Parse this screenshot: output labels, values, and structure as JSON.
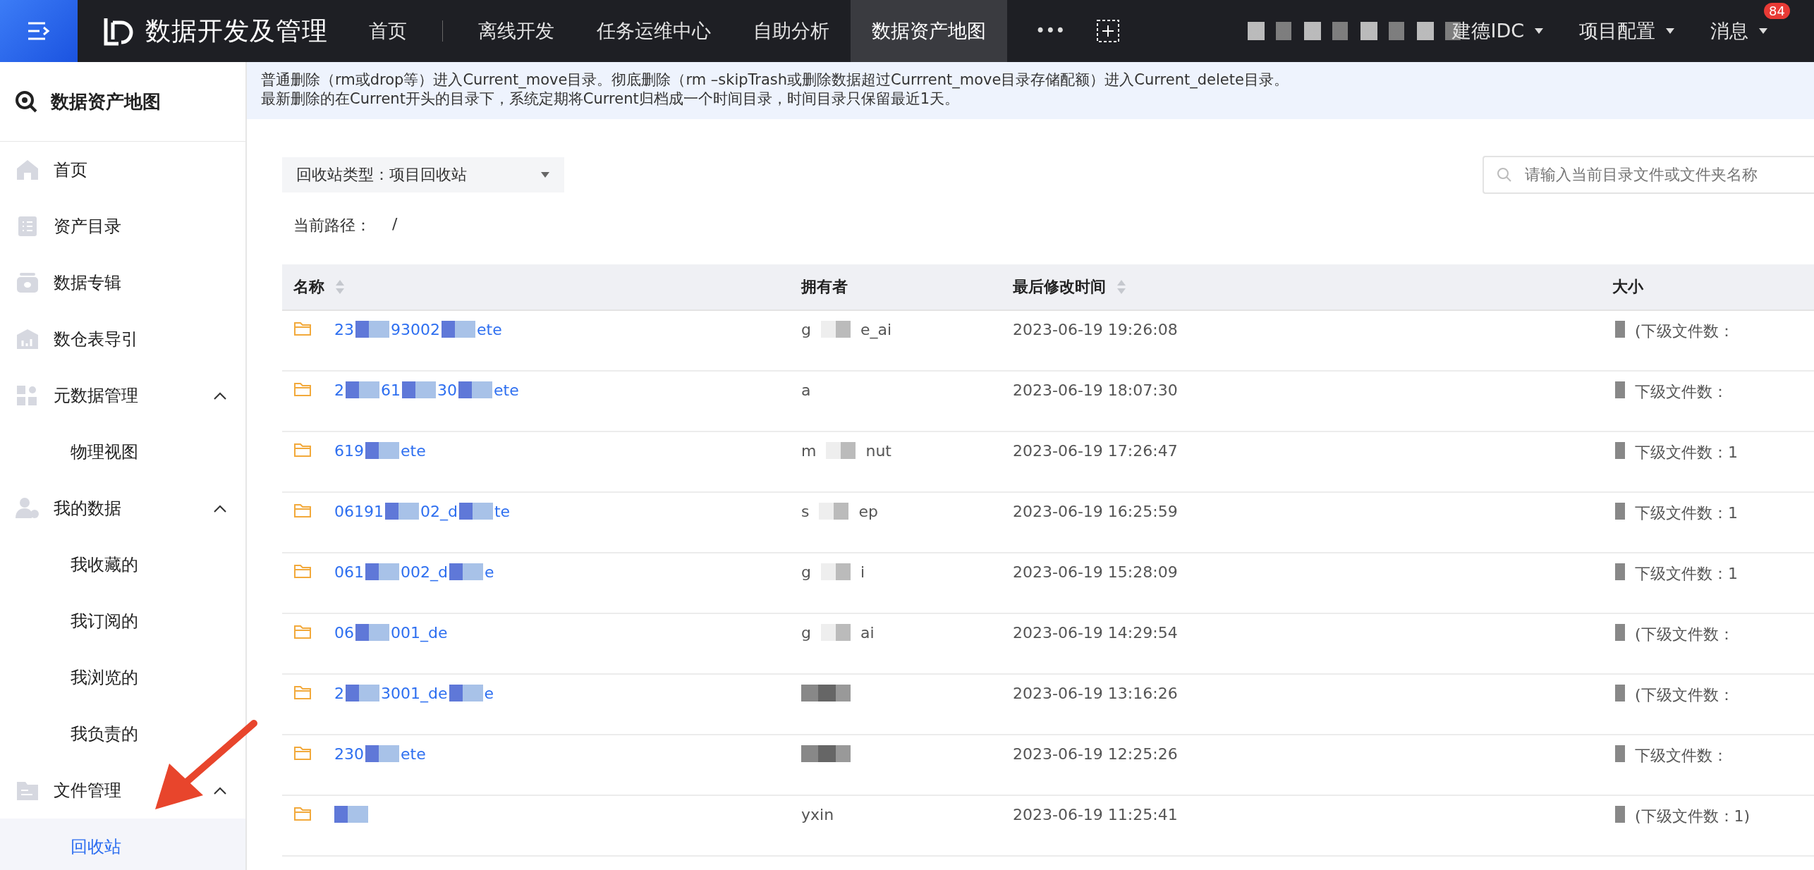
{
  "topbar": {
    "app_title": "数据开发及管理",
    "nav": [
      {
        "label": "首页",
        "selected": false
      },
      {
        "label": "离线开发",
        "selected": false
      },
      {
        "label": "任务运维中心",
        "selected": false
      },
      {
        "label": "自助分析",
        "selected": false
      },
      {
        "label": "数据资产地图",
        "selected": true
      }
    ],
    "more": "•••",
    "right": [
      {
        "label": "建德IDC"
      },
      {
        "label": "项目配置"
      },
      {
        "label": "消息",
        "badge": "84"
      }
    ]
  },
  "sidebar": {
    "title": "数据资产地图",
    "items": [
      {
        "label": "首页",
        "selected": false
      },
      {
        "label": "资产目录",
        "selected": false
      },
      {
        "label": "数据专辑",
        "selected": false
      },
      {
        "label": "数仓表导引",
        "selected": false
      },
      {
        "label": "元数据管理",
        "selected": false,
        "expanded": true,
        "children": [
          {
            "label": "物理视图",
            "selected": false
          }
        ]
      },
      {
        "label": "我的数据",
        "selected": false,
        "expanded": true,
        "children": [
          {
            "label": "我收藏的",
            "selected": false
          },
          {
            "label": "我订阅的",
            "selected": false
          },
          {
            "label": "我浏览的",
            "selected": false
          },
          {
            "label": "我负责的",
            "selected": false
          }
        ]
      },
      {
        "label": "文件管理",
        "selected": false,
        "expanded": true,
        "children": [
          {
            "label": "回收站",
            "selected": true
          }
        ]
      }
    ]
  },
  "notice": [
    "普通删除（rm或drop等）进入Current_move目录。彻底删除（rm –skipTrash或删除数据超过Currrent_move目录存储配额）进入Current_delete目录。",
    "最新删除的在Current开头的目录下，系统定期将Current归档成一个时间目录，时间目录只保留最近1天。"
  ],
  "filter": {
    "type_label": "回收站类型：",
    "type_value": "项目回收站",
    "search_placeholder": "请输入当前目录文件或文件夹名称"
  },
  "path": {
    "label": "当前路径：",
    "value": "/"
  },
  "table": {
    "columns": [
      {
        "label": "名称",
        "sortable": true
      },
      {
        "label": "拥有者",
        "sortable": false
      },
      {
        "label": "最后修改时间",
        "sortable": true
      },
      {
        "label": "大小",
        "sortable": false
      }
    ],
    "rows": [
      {
        "name": [
          "23",
          "93002",
          "ete"
        ],
        "owner": [
          "g",
          "e_ai"
        ],
        "time": "2023-06-19 19:26:08",
        "size": [
          "(下级文件数："
        ]
      },
      {
        "name": [
          "2",
          "61",
          "30",
          "ete"
        ],
        "owner": [
          "a"
        ],
        "time": "2023-06-19 18:07:30",
        "size": [
          "下级文件数："
        ]
      },
      {
        "name": [
          "619",
          "ete"
        ],
        "owner": [
          "m",
          "nut"
        ],
        "time": "2023-06-19 17:26:47",
        "size": [
          "下级文件数：1"
        ]
      },
      {
        "name": [
          "06191",
          "02_d",
          "te"
        ],
        "owner": [
          "s",
          "ep"
        ],
        "time": "2023-06-19 16:25:59",
        "size": [
          "下级文件数：1"
        ]
      },
      {
        "name": [
          "061",
          "002_d",
          "e"
        ],
        "owner": [
          "g",
          "i"
        ],
        "time": "2023-06-19 15:28:09",
        "size": [
          "下级文件数：1"
        ]
      },
      {
        "name": [
          "06",
          "001_de"
        ],
        "owner": [
          "g",
          "ai"
        ],
        "time": "2023-06-19 14:29:54",
        "size": [
          "(下级文件数："
        ]
      },
      {
        "name": [
          "2",
          "3001_de",
          "e"
        ],
        "time": "2023-06-19 13:16:26",
        "size": [
          "(下级文件数："
        ]
      },
      {
        "name": [
          "230",
          "ete"
        ],
        "time": "2023-06-19 12:25:26",
        "size": [
          "下级文件数："
        ]
      },
      {
        "owner": [
          "yxin"
        ],
        "time": "2023-06-19 11:25:41",
        "size": [
          "(下级文件数：1)"
        ]
      }
    ]
  }
}
